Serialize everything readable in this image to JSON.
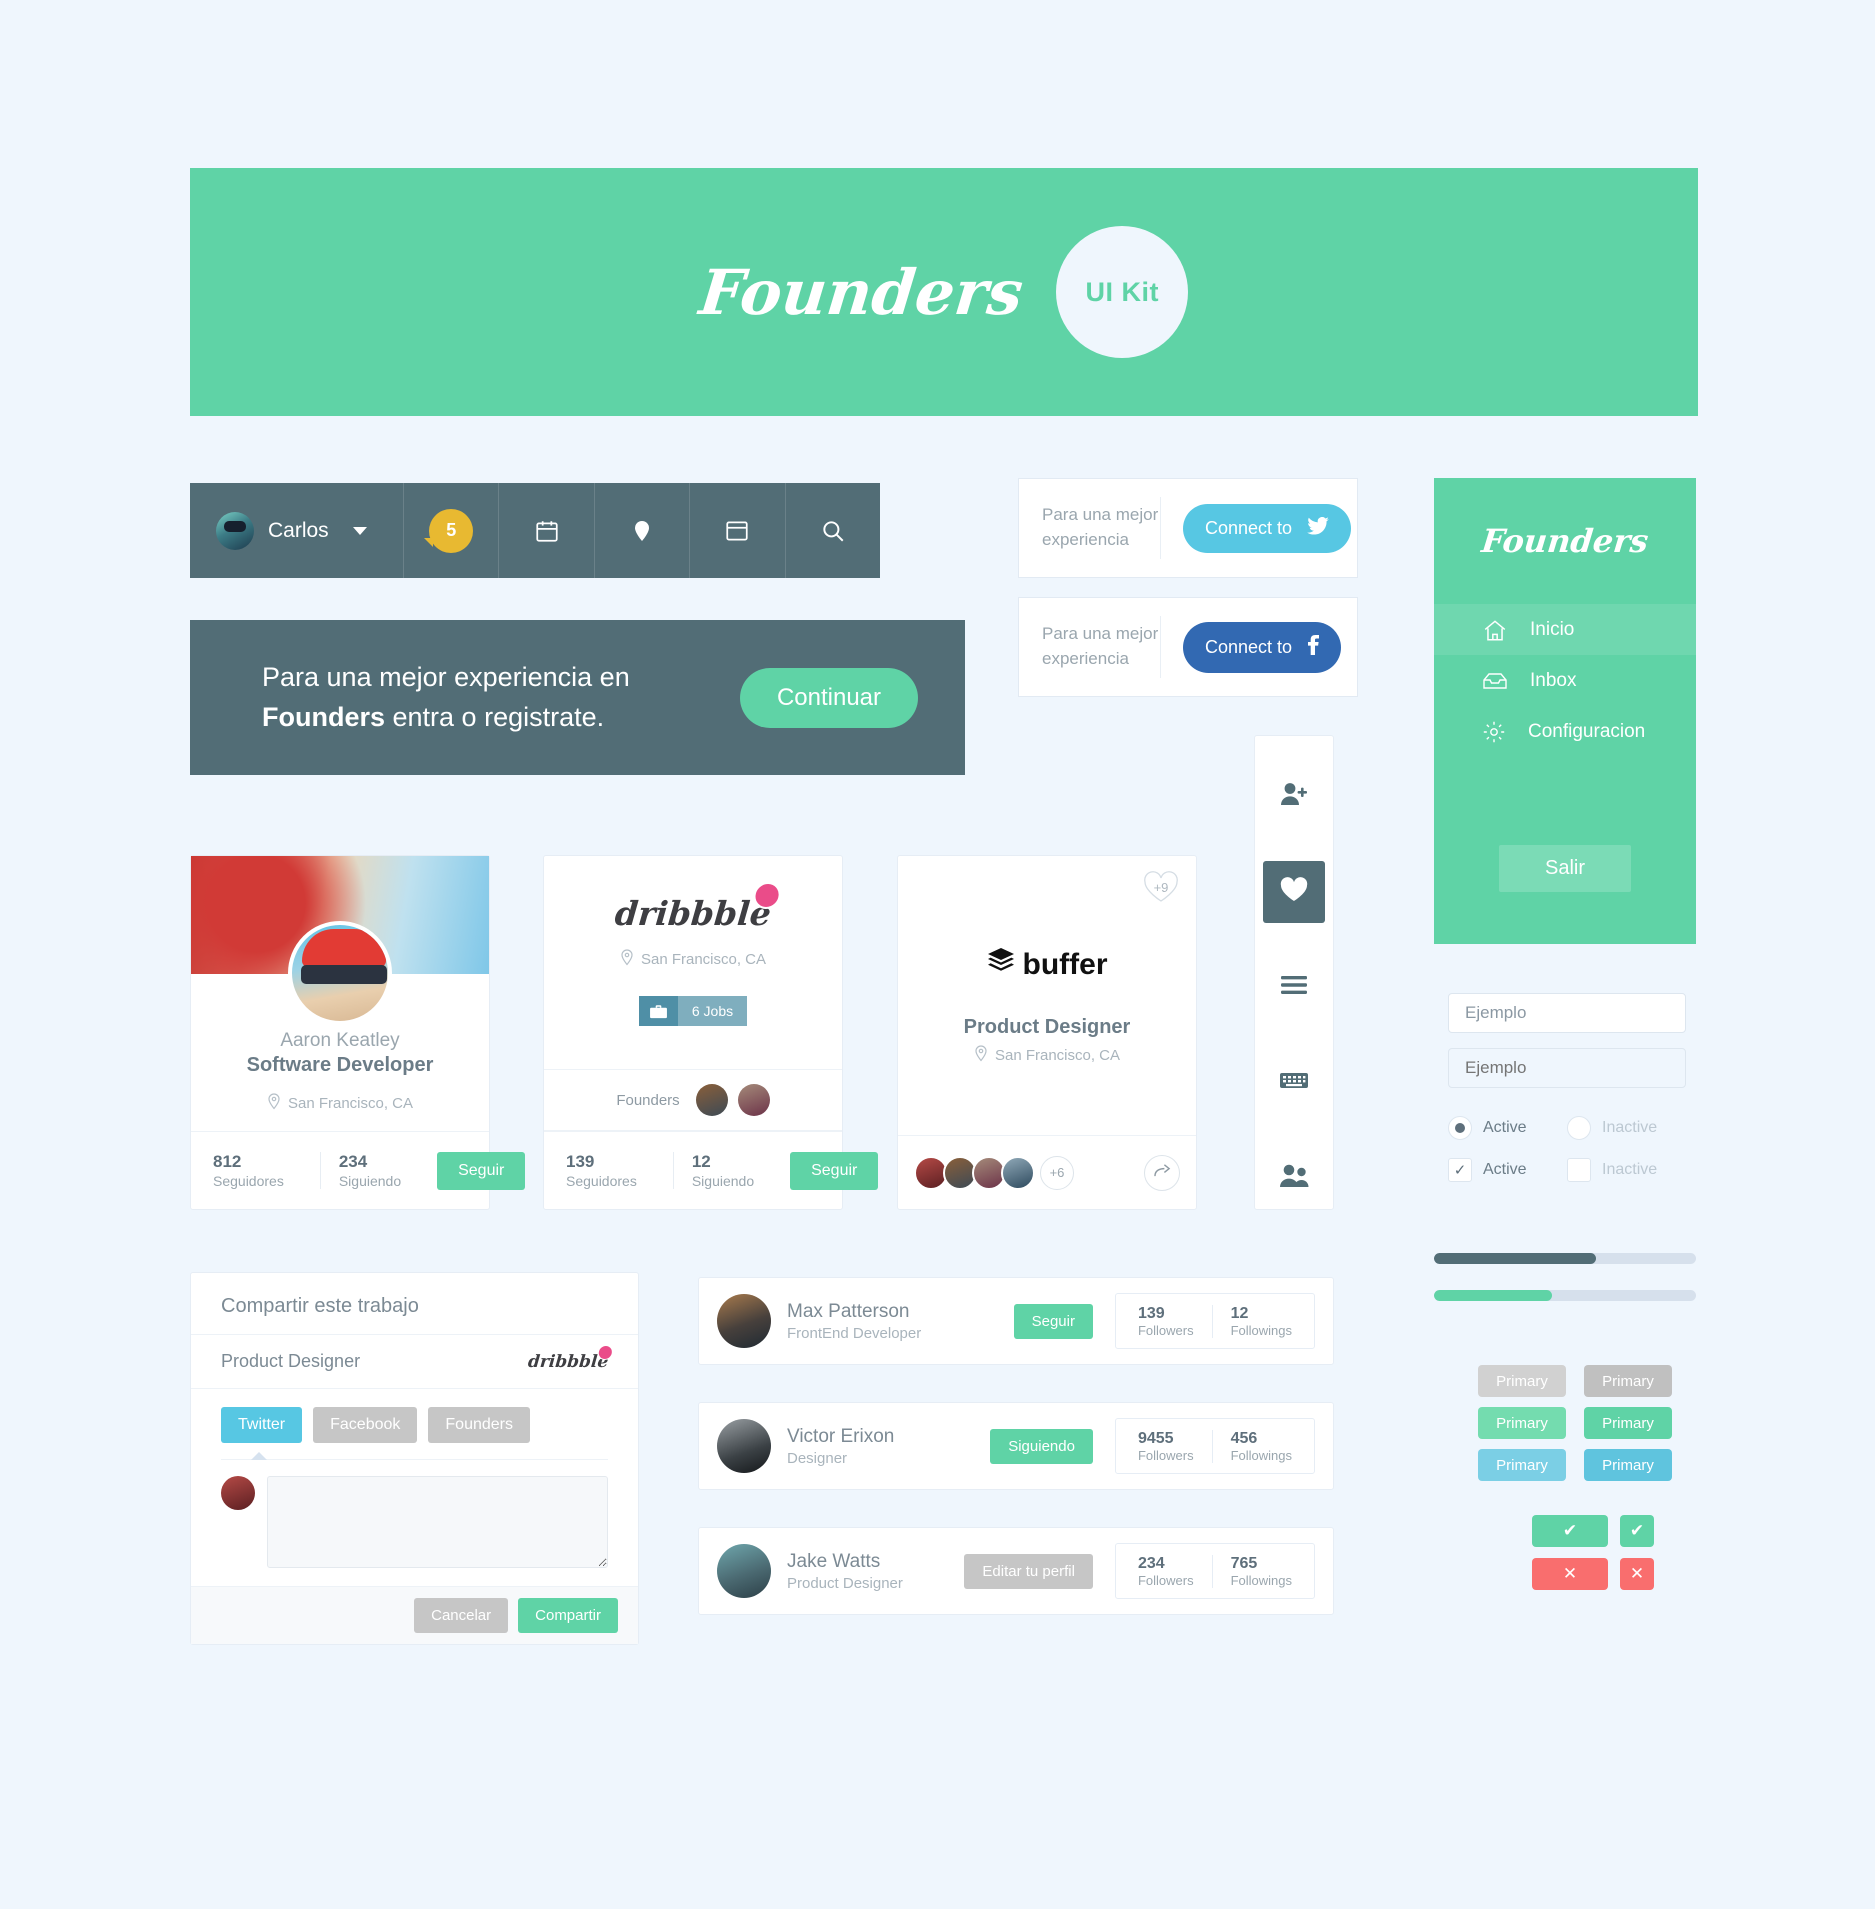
{
  "hero": {
    "logo": "Founders",
    "badge": "UI Kit"
  },
  "navbar": {
    "user_name": "Carlos",
    "badge_count": "5",
    "icons": [
      "avatar",
      "chevron-down-icon",
      "notification-badge",
      "calendar-icon",
      "location-pin-icon",
      "window-icon",
      "search-icon"
    ]
  },
  "cta": {
    "line1": "Para una mejor experiencia en",
    "brand": "Founders",
    "line2": " entra o registrate.",
    "button": "Continuar"
  },
  "connect": [
    {
      "label": "Para una mejor experiencia",
      "button": "Connect to",
      "network": "twitter-icon",
      "color": "#57C7E3"
    },
    {
      "label": "Para una mejor experiencia",
      "button": "Connect to",
      "network": "facebook-icon",
      "color": "#3269B2"
    }
  ],
  "sidebar": {
    "logo": "Founders",
    "items": [
      {
        "label": "Inicio",
        "icon": "home-icon",
        "active": true
      },
      {
        "label": "Inbox",
        "icon": "inbox-icon",
        "active": false
      },
      {
        "label": "Configuracion",
        "icon": "gear-icon",
        "active": false
      }
    ],
    "logout": "Salir"
  },
  "card_profile": {
    "name": "Aaron Keatley",
    "role": "Software Developer",
    "location": "San Francisco, CA",
    "stats": [
      {
        "num": "812",
        "label": "Seguidores"
      },
      {
        "num": "234",
        "label": "Siguiendo"
      }
    ],
    "button": "Seguir"
  },
  "card_dribbble": {
    "logo": "dribbble",
    "location": "San Francisco, CA",
    "jobs_badge": "6 Jobs",
    "founders_label": "Founders",
    "stats": [
      {
        "num": "139",
        "label": "Seguidores"
      },
      {
        "num": "12",
        "label": "Siguiendo"
      }
    ],
    "button": "Seguir"
  },
  "card_buffer": {
    "heart_count": "+9",
    "logo": "buffer",
    "role": "Product Designer",
    "location": "San Francisco, CA",
    "overflow_count": "+6"
  },
  "vtoolbar": {
    "items": [
      {
        "icon": "add-user-icon",
        "active": false
      },
      {
        "icon": "heart-icon",
        "active": true
      },
      {
        "icon": "menu-icon",
        "active": false
      },
      {
        "icon": "keyboard-icon",
        "active": false
      },
      {
        "icon": "users-icon",
        "active": false
      }
    ]
  },
  "dialog": {
    "title": "Compartir este trabajo",
    "subject": "Product Designer",
    "source_logo": "dribbble",
    "tabs": [
      {
        "label": "Twitter",
        "active": true
      },
      {
        "label": "Facebook",
        "active": false
      },
      {
        "label": "Founders",
        "active": false
      }
    ],
    "textarea_value": "",
    "cancel": "Cancelar",
    "share": "Compartir"
  },
  "user_rows": [
    {
      "name": "Max Patterson",
      "role": "FrontEnd Developer",
      "action": "Seguir",
      "action_style": "green",
      "stats": [
        {
          "num": "139",
          "label": "Followers"
        },
        {
          "num": "12",
          "label": "Followings"
        }
      ]
    },
    {
      "name": "Victor Erixon",
      "role": "Designer",
      "action": "Siguiendo",
      "action_style": "green",
      "stats": [
        {
          "num": "9455",
          "label": "Followers"
        },
        {
          "num": "456",
          "label": "Followings"
        }
      ]
    },
    {
      "name": "Jake Watts",
      "role": "Product Designer",
      "action": "Editar  tu perfil",
      "action_style": "grey",
      "stats": [
        {
          "num": "234",
          "label": "Followers"
        },
        {
          "num": "765",
          "label": "Followings"
        }
      ]
    }
  ],
  "form": {
    "input_filled_value": "Ejemplo",
    "input_empty_placeholder": "Ejemplo",
    "radio_on_label": "Active",
    "radio_off_label": "Inactive",
    "check_on_label": "Active",
    "check_off_label": "Inactive"
  },
  "progress": [
    {
      "percent": 62,
      "color": "#526D76"
    },
    {
      "percent": 45,
      "color": "#5FD3A6"
    }
  ],
  "buttons": {
    "primary_label": "Primary",
    "grid": [
      [
        "Primary",
        "Primary"
      ],
      [
        "Primary",
        "Primary"
      ],
      [
        "Primary",
        "Primary"
      ]
    ],
    "check_glyph": "✔",
    "cross_glyph": "✕"
  },
  "colors": {
    "brand_green": "#5FD3A6",
    "dark_slate": "#526D76",
    "page_bg": "#EFF6FD",
    "twitter_blue": "#57C7E3",
    "facebook_blue": "#3269B2",
    "danger_red": "#F96E6E",
    "badge_yellow": "#E8B931",
    "muted_grey": "#C6C6C6"
  }
}
